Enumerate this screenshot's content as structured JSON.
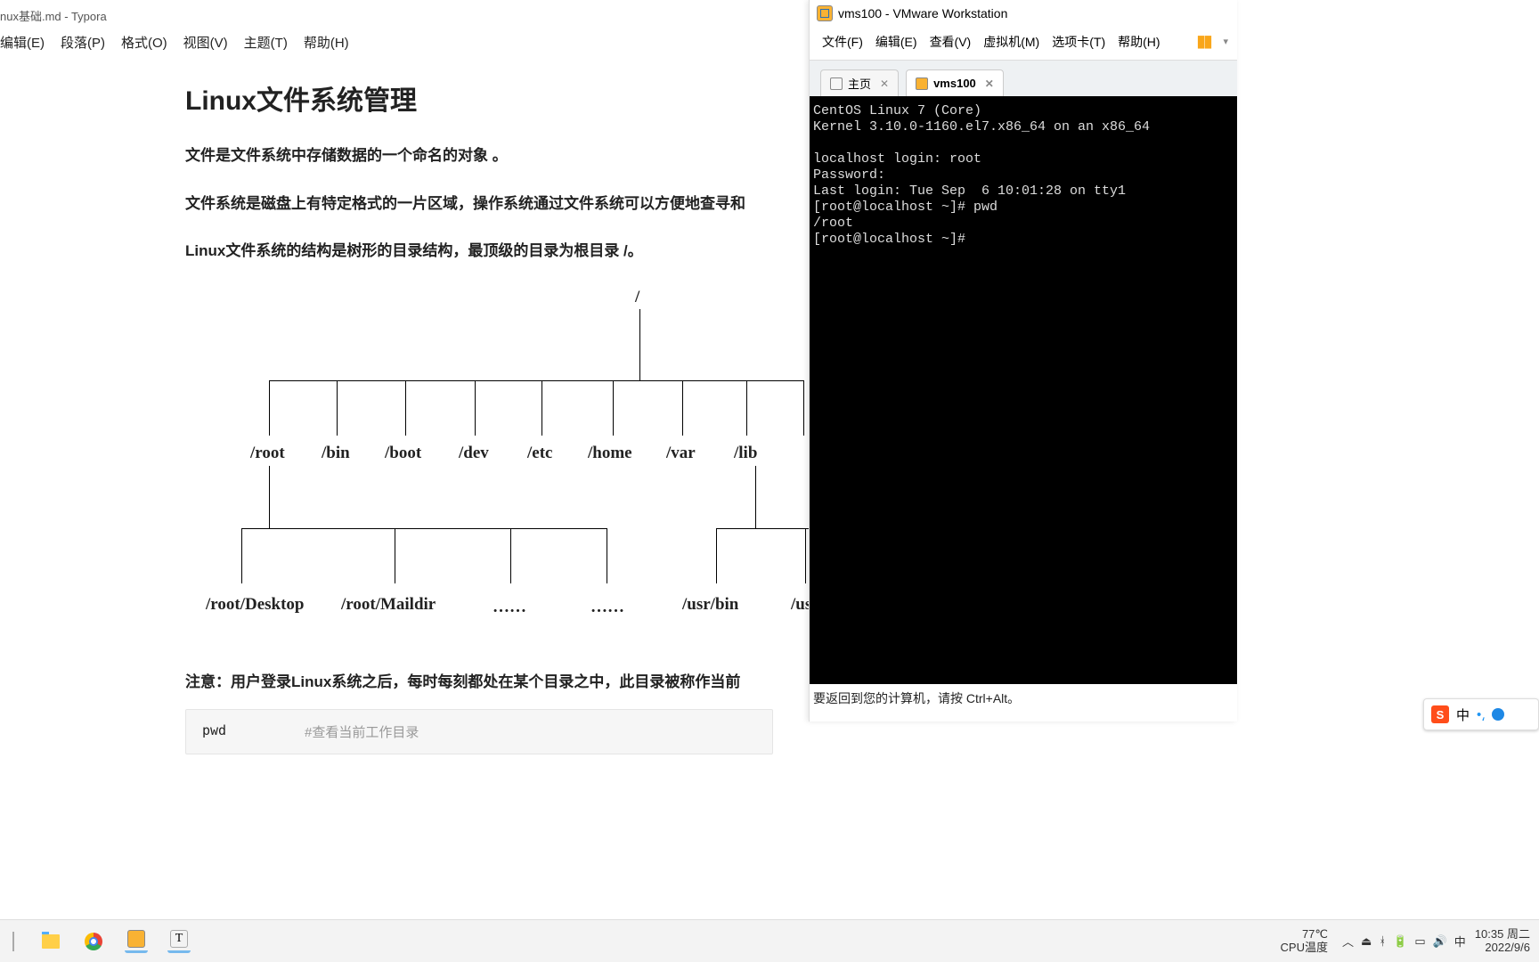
{
  "typora": {
    "title": "nux基础.md - Typora",
    "menu": [
      "编辑(E)",
      "段落(P)",
      "格式(O)",
      "视图(V)",
      "主题(T)",
      "帮助(H)"
    ],
    "doc": {
      "heading": "Linux文件系统管理",
      "p1": "文件是文件系统中存储数据的一个命名的对象 。",
      "p2": "文件系统是磁盘上有特定格式的一片区域，操作系统通过文件系统可以方便地查寻和",
      "p3": "Linux文件系统的结构是树形的目录结构，最顶级的目录为根目录 /。",
      "note": "注意：用户登录Linux系统之后，每时每刻都处在某个目录之中，此目录被称作当前",
      "code_cmd": "pwd",
      "code_cmt": "#查看当前工作目录",
      "tree": {
        "root": "/",
        "level1": [
          "/root",
          "/bin",
          "/boot",
          "/dev",
          "/etc",
          "/home",
          "/var",
          "/lib"
        ],
        "level2_left": [
          "/root/Desktop",
          "/root/Maildir",
          "……",
          "……"
        ],
        "level2_right": [
          "/usr/bin",
          "/us"
        ]
      }
    }
  },
  "vmware": {
    "title": "vms100 - VMware Workstation",
    "menu": [
      "文件(F)",
      "编辑(E)",
      "查看(V)",
      "虚拟机(M)",
      "选项卡(T)",
      "帮助(H)"
    ],
    "tabs": {
      "home": "主页",
      "vm": "vms100"
    },
    "console": "CentOS Linux 7 (Core)\nKernel 3.10.0-1160.el7.x86_64 on an x86_64\n\nlocalhost login: root\nPassword:\nLast login: Tue Sep  6 10:01:28 on tty1\n[root@localhost ~]# pwd\n/root\n[root@localhost ~]#",
    "status": "要返回到您的计算机，请按 Ctrl+Alt。"
  },
  "ime": {
    "lang": "中",
    "brand": "S"
  },
  "taskbar": {
    "temp": "77℃",
    "temp_label": "CPU温度",
    "time": "10:35",
    "day": "周二",
    "date": "2022/9/6",
    "tray_chevron": "︿"
  }
}
